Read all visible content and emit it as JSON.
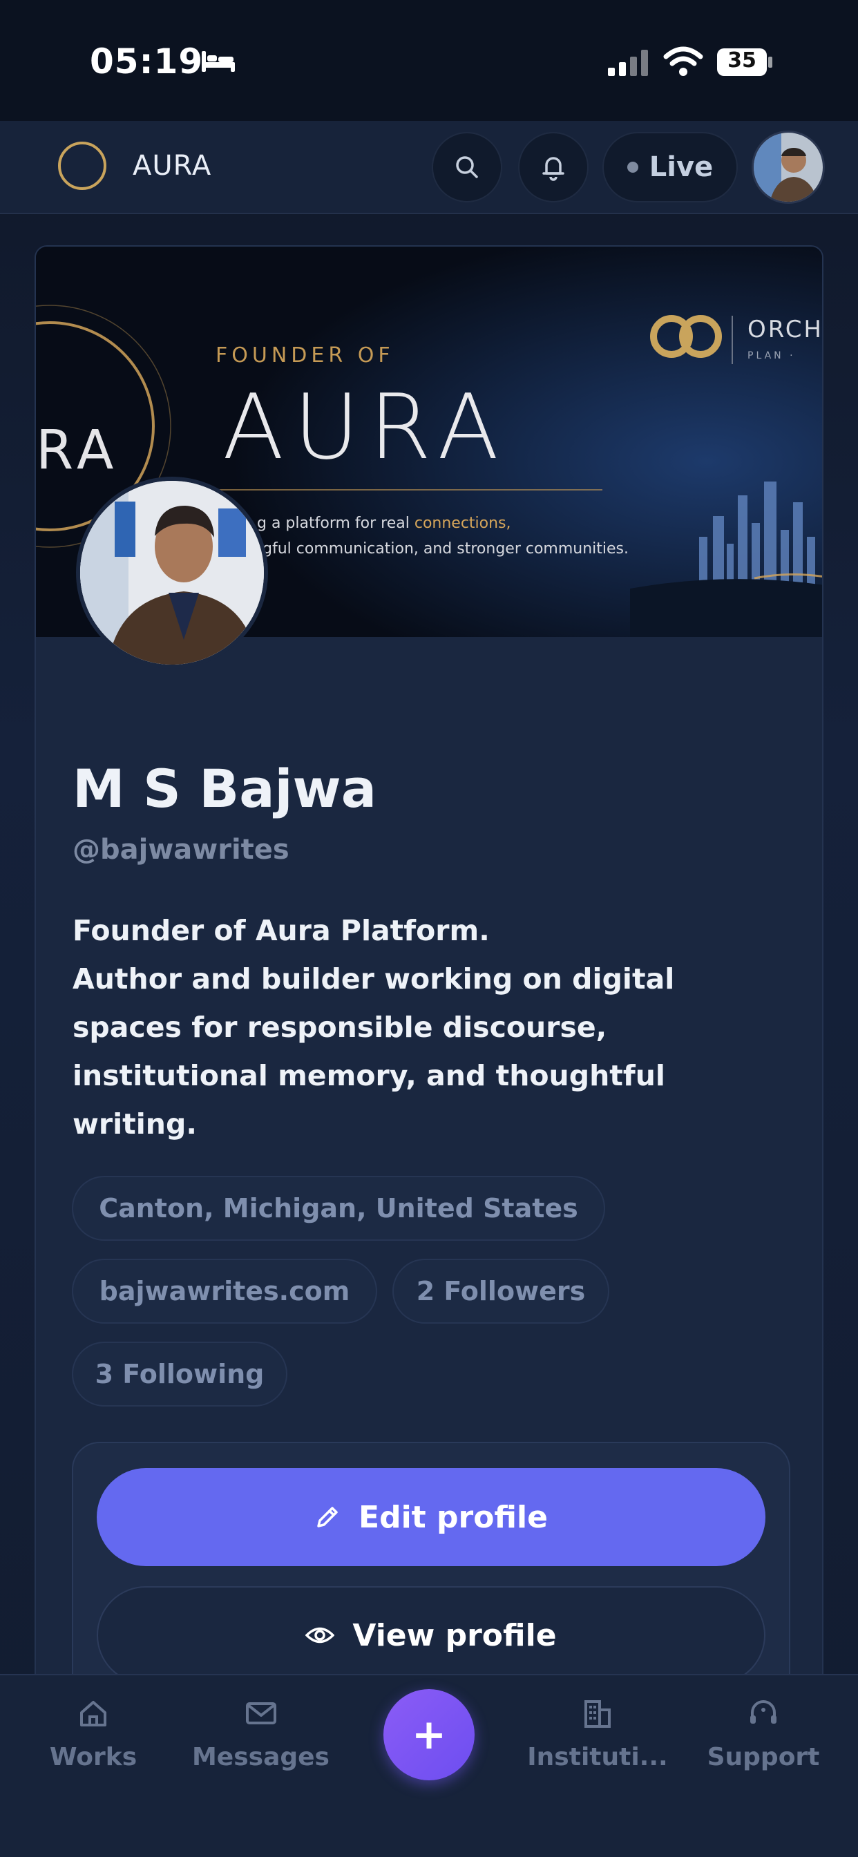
{
  "status_bar": {
    "time": "05:19",
    "battery": "35"
  },
  "header": {
    "brand": "AURA",
    "live_label": "Live"
  },
  "banner": {
    "founder_label": "FOUNDER OF",
    "title": "AURA",
    "tagline_line1_prefix": "g a platform for real ",
    "tagline_line1_accent": "connections,",
    "tagline_line2_prefix": "gful communication, and stronger communities.",
    "left_fragment": "RA",
    "partner_name": "ORCH",
    "partner_sub": "PLAN · "
  },
  "profile": {
    "name": "M S Bajwa",
    "handle": "@bajwawrites",
    "bio": "Founder of Aura Platform.\nAuthor and builder working on digital spaces for responsible discourse, institutional memory, and thoughtful writing.",
    "location": "Canton, Michigan, United States",
    "website": "bajwawrites.com",
    "followers": "2 Followers",
    "following": "3 Following"
  },
  "actions": {
    "edit_label": "Edit profile",
    "view_label": "View profile"
  },
  "bottom_nav": {
    "works": "Works",
    "messages": "Messages",
    "add": "+",
    "institutions": "Instituti...",
    "support": "Support"
  },
  "colors": {
    "accent": "#6469f0",
    "fab": "#7c55f4",
    "gold": "#c9a45c",
    "background": "#15213a"
  }
}
